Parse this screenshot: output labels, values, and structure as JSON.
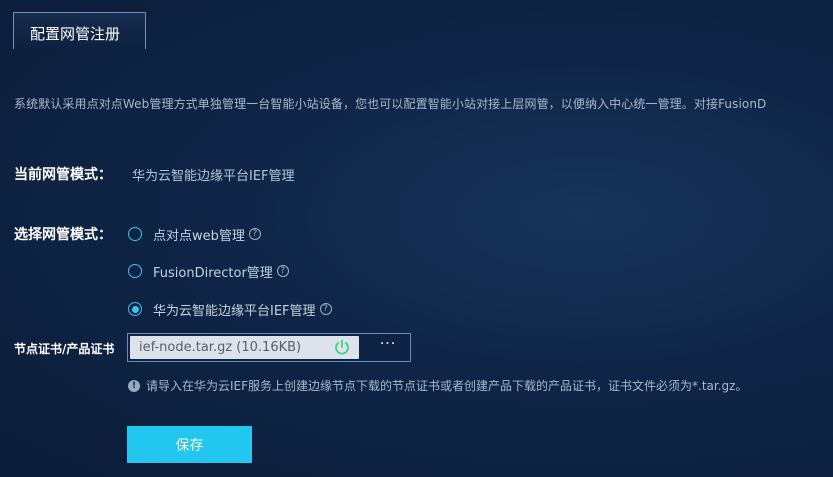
{
  "tab": {
    "label": "配置网管注册"
  },
  "description": "系统默认采用点对点Web管理方式单独管理一台智能小站设备，您也可以配置智能小站对接上层网管，以便纳入中心统一管理。对接FusionD",
  "current_mode": {
    "label": "当前网管模式：",
    "value": "华为云智能边缘平台IEF管理"
  },
  "select_mode": {
    "label": "选择网管模式：",
    "options": [
      {
        "label": "点对点web管理",
        "checked": false
      },
      {
        "label": "FusionDirector管理",
        "checked": false
      },
      {
        "label": "华为云智能边缘平台IEF管理",
        "checked": true
      }
    ]
  },
  "certificate": {
    "label": "节点证书/产品证书",
    "file_name": "ief-node.tar.gz (10.16KB)",
    "more_label": "···",
    "hint": "请导入在华为云IEF服务上创建边缘节点下载的节点证书或者创建产品下载的产品证书，证书文件必须为*.tar.gz。"
  },
  "save_label": "保存",
  "help_glyph": "?",
  "info_glyph": "!",
  "colors": {
    "accent": "#22c7ef",
    "radio": "#3ec3ee",
    "background": "#0f2547",
    "success": "#3fcf8e"
  }
}
